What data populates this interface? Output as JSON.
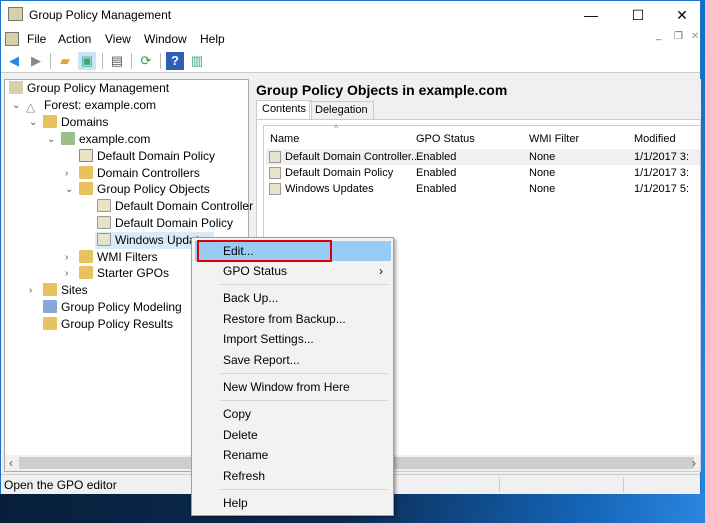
{
  "window": {
    "title": "Group Policy Management",
    "controls": {
      "minimize": "—",
      "maximize": "☐",
      "close": "✕"
    }
  },
  "menubar": [
    "File",
    "Action",
    "View",
    "Window",
    "Help"
  ],
  "toolbar": [
    "back-icon",
    "forward-icon",
    "up-folder-icon",
    "show-hide-tree-icon",
    "clipboard-icon",
    "refresh-icon",
    "help-icon",
    "console-tree-icon"
  ],
  "tree": {
    "root": "Group Policy Management",
    "forest": "Forest: example.com",
    "domains": "Domains",
    "domain": "example.com",
    "ddp": "Default Domain Policy",
    "dc": "Domain Controllers",
    "gpo": "Group Policy Objects",
    "gpo_items": [
      "Default Domain Controller",
      "Default Domain Policy",
      "Windows Updates"
    ],
    "wmi": "WMI Filters",
    "starter": "Starter GPOs",
    "sites": "Sites",
    "modeling": "Group Policy Modeling",
    "results": "Group Policy Results"
  },
  "right": {
    "title": "Group Policy Objects in example.com",
    "tabs": [
      "Contents",
      "Delegation"
    ],
    "columns": [
      "Name",
      "GPO Status",
      "WMI Filter",
      "Modified"
    ],
    "rows": [
      {
        "name": "Default Domain Controller...",
        "status": "Enabled",
        "wmi": "None",
        "modified": "1/1/2017 3:"
      },
      {
        "name": "Default Domain Policy",
        "status": "Enabled",
        "wmi": "None",
        "modified": "1/1/2017 3:"
      },
      {
        "name": "Windows Updates",
        "status": "Enabled",
        "wmi": "None",
        "modified": "1/1/2017 5:"
      }
    ]
  },
  "status": "Open the GPO editor",
  "context_menu": {
    "items": [
      "Edit...",
      "GPO Status",
      "Back Up...",
      "Restore from Backup...",
      "Import Settings...",
      "Save Report...",
      "New Window from Here",
      "Copy",
      "Delete",
      "Rename",
      "Refresh",
      "Help"
    ],
    "highlight_color": "#e00000",
    "hover_color": "#99ccf5"
  }
}
